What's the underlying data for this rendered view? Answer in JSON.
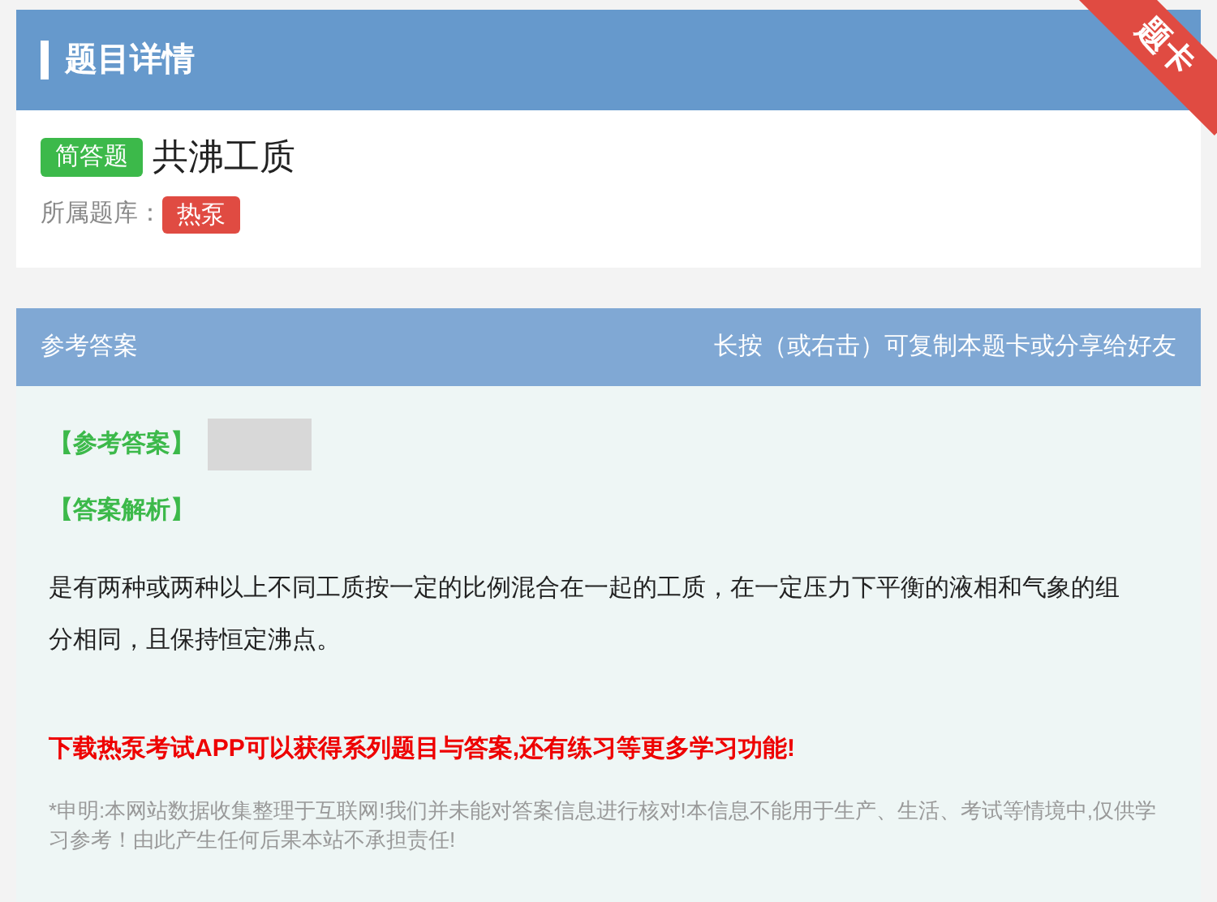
{
  "header": {
    "title": "题目详情",
    "ribbon": "题卡"
  },
  "question": {
    "type_badge": "简答题",
    "title": "共沸工质",
    "bank_label": "所属题库：",
    "bank_tag": "热泵"
  },
  "answer_panel": {
    "title": "参考答案",
    "hint": "长按（或右击）可复制本题卡或分享给好友",
    "answer_label": "【参考答案】",
    "analysis_label": "【答案解析】",
    "analysis": "是有两种或两种以上不同工质按一定的比例混合在一起的工质，在一定压力下平衡的液相和气象的组分相同，且保持恒定沸点。",
    "promo": "下载热泵考试APP可以获得系列题目与答案,还有练习等更多学习功能!",
    "disclaimer": "*申明:本网站数据收集整理于互联网!我们并未能对答案信息进行核对!本信息不能用于生产、生活、考试等情境中,仅供学习参考！由此产生任何后果本站不承担责任!"
  }
}
